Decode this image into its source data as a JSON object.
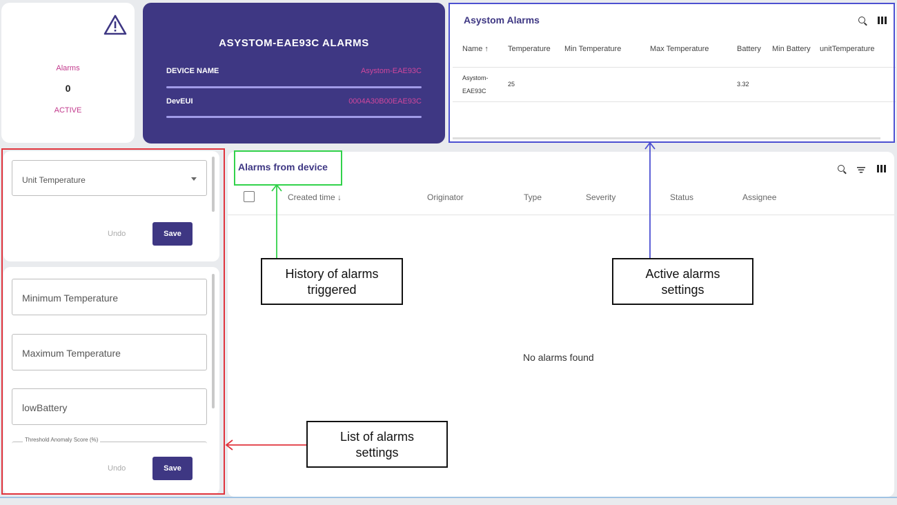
{
  "counter": {
    "alarms_label": "Alarms",
    "count": "0",
    "state": "ACTIVE",
    "icon": "warning-triangle-icon"
  },
  "device": {
    "title": "ASYSTOM-EAE93C ALARMS",
    "name_key": "DEVICE NAME",
    "name_value": "Asystom-EAE93C",
    "eui_key": "DevEUI",
    "eui_value": "0004A30B00EAE93C"
  },
  "asystom_table": {
    "title": "Asystom Alarms",
    "columns": [
      "Name ↑",
      "Temperature",
      "Min Temperature",
      "Max Temperature",
      "Battery",
      "Min Battery",
      "unitTemperature"
    ],
    "rows": [
      {
        "name_line1": "Asystom-",
        "name_line2": "EAE93C",
        "temperature": "25",
        "battery": "3.32"
      }
    ]
  },
  "settings_top": {
    "select_placeholder": "Unit Temperature",
    "undo": "Undo",
    "save": "Save"
  },
  "settings_bottom": {
    "min_temp": "Minimum Temperature",
    "max_temp": "Maximum Temperature",
    "low_battery": "lowBattery",
    "threshold": "Threshold Anomaly Score (%)",
    "undo": "Undo",
    "save": "Save"
  },
  "device_alarms": {
    "title": "Alarms from device",
    "columns": [
      "Created time ↓",
      "Originator",
      "Type",
      "Severity",
      "Status",
      "Assignee"
    ],
    "empty": "No alarms found"
  },
  "annotations": {
    "history": "History of alarms triggered",
    "history_line1": "History of alarms",
    "history_line2": "triggered",
    "active_line1": "Active alarms",
    "active_line2": "settings",
    "list_line1": "List of alarms",
    "list_line2": "settings",
    "colors": {
      "blue": "#4b4fd1",
      "green": "#31d24a",
      "red": "#e0333c"
    }
  },
  "theme": {
    "primary": "#3e3783",
    "accent": "#c2398c"
  }
}
